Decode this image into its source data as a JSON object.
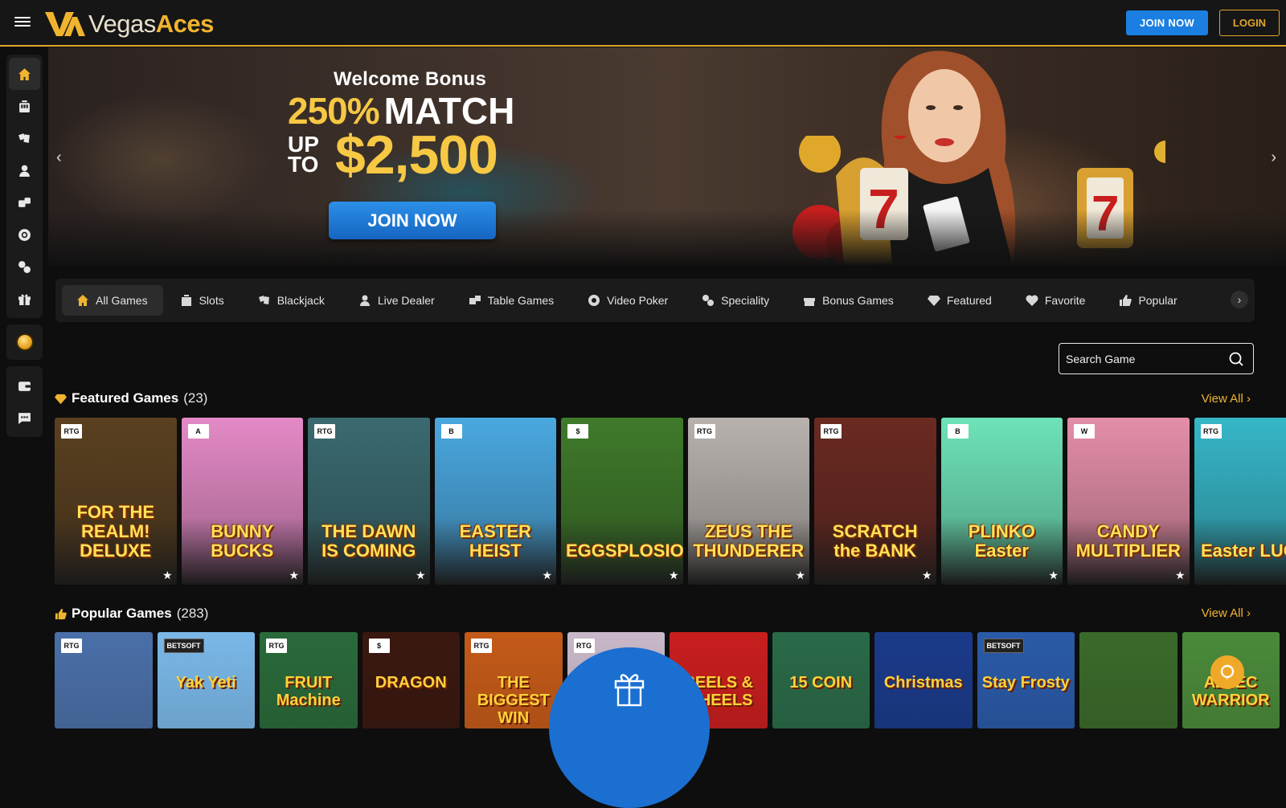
{
  "brand": {
    "vegas": "Vegas",
    "aces": "Aces"
  },
  "header": {
    "join_label": "JOIN NOW",
    "login_label": "LOGIN"
  },
  "sidebar": {
    "items": [
      {
        "name": "home-icon"
      },
      {
        "name": "slots-icon"
      },
      {
        "name": "blackjack-icon"
      },
      {
        "name": "live-dealer-icon"
      },
      {
        "name": "table-games-icon"
      },
      {
        "name": "video-poker-icon"
      },
      {
        "name": "speciality-icon"
      },
      {
        "name": "bonus-games-icon"
      }
    ],
    "extra": [
      "coin-icon",
      "wallet-icon",
      "chat-icon"
    ]
  },
  "banner": {
    "welcome": "Welcome Bonus",
    "pct": "250%",
    "match": "MATCH",
    "up": "UP",
    "to": "TO",
    "amount": "$2,500",
    "cta": "JOIN NOW"
  },
  "categories": [
    {
      "label": "All Games",
      "icon": "home-icon",
      "active": true
    },
    {
      "label": "Slots",
      "icon": "slots-icon"
    },
    {
      "label": "Blackjack",
      "icon": "blackjack-icon"
    },
    {
      "label": "Live Dealer",
      "icon": "live-dealer-icon"
    },
    {
      "label": "Table Games",
      "icon": "table-games-icon"
    },
    {
      "label": "Video Poker",
      "icon": "video-poker-icon"
    },
    {
      "label": "Speciality",
      "icon": "speciality-icon"
    },
    {
      "label": "Bonus Games",
      "icon": "bonus-games-icon"
    },
    {
      "label": "Featured",
      "icon": "diamond-icon"
    },
    {
      "label": "Favorite",
      "icon": "heart-icon"
    },
    {
      "label": "Popular",
      "icon": "thumbs-up-icon"
    }
  ],
  "search": {
    "placeholder": "Search Game"
  },
  "featured": {
    "title": "Featured Games",
    "count": "(23)",
    "view_all": "View All ›",
    "games": [
      {
        "title": "FOR THE REALM! DELUXE",
        "provider": "RTG",
        "bg": "#5a4020"
      },
      {
        "title": "BUNNY BUCKS",
        "provider": "A",
        "bg": "#e48ac6"
      },
      {
        "title": "THE DAWN IS COMING",
        "provider": "RTG",
        "bg": "#3a6a70"
      },
      {
        "title": "EASTER HEIST",
        "provider": "B",
        "bg": "#4aa8e0"
      },
      {
        "title": "EGGSPLOSION",
        "provider": "$",
        "bg": "#3f7a2a"
      },
      {
        "title": "ZEUS THE THUNDERER",
        "provider": "RTG",
        "bg": "#b8b2ae"
      },
      {
        "title": "SCRATCH the BANK",
        "provider": "RTG",
        "bg": "#6a2a22"
      },
      {
        "title": "PLINKO Easter",
        "provider": "B",
        "bg": "#6ee3b8"
      },
      {
        "title": "CANDY MULTIPLIER",
        "provider": "W",
        "bg": "#e48ea8"
      },
      {
        "title": "Easter LUCK",
        "provider": "RTG",
        "bg": "#36b7c8"
      }
    ]
  },
  "popular": {
    "title": "Popular Games",
    "count": "(283)",
    "view_all": "View All ›",
    "games": [
      {
        "title": "",
        "provider": "RTG",
        "bg": "#4a6fa8"
      },
      {
        "title": "Yak Yeti",
        "provider": "BETSOFT",
        "bg": "#7ab8e8"
      },
      {
        "title": "FRUIT Machine",
        "provider": "RTG",
        "bg": "#2a6a3a"
      },
      {
        "title": "DRAGON",
        "provider": "$",
        "bg": "#3a1810"
      },
      {
        "title": "THE BIGGEST WIN",
        "provider": "RTG",
        "bg": "#c45a18"
      },
      {
        "title": "",
        "provider": "RTG",
        "bg": "#c8b8c8"
      },
      {
        "title": "REELS & WHEELS",
        "provider": "",
        "bg": "#c81e1e"
      },
      {
        "title": "15 COIN",
        "provider": "",
        "bg": "#2a6a48"
      },
      {
        "title": "Christmas",
        "provider": "",
        "bg": "#1a3a8a"
      },
      {
        "title": "Stay Frosty",
        "provider": "BETSOFT",
        "bg": "#2a5aa8"
      },
      {
        "title": "",
        "provider": "",
        "bg": "#3a6a2a"
      },
      {
        "title": "AZTEC WARRIOR",
        "provider": "",
        "bg": "#4a8a3a"
      }
    ]
  }
}
